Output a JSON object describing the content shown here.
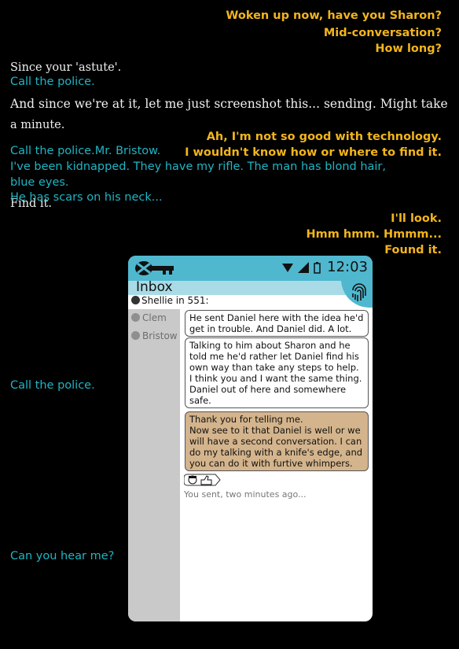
{
  "narration": {
    "yellow_top": [
      "Woken up now, have you Sharon?",
      "Mid-conversation?",
      "How long?"
    ],
    "white_1": "Since your 'astute'.",
    "cyan_1": "Call the police.",
    "white_2": "And since we're at it, let me just screenshot this... sending.  Might take",
    "white_2b": "a minute.",
    "yellow_mid_1": "Ah, I'm not so good with technology.",
    "yellow_mid_2": "I wouldn't know how or where to find it.",
    "cyan_2a": "Call the police.Mr. Bristow.",
    "cyan_2b": "I've been kidnapped.  They have my rifle.  The man has blond hair,",
    "cyan_2c": "blue eyes.",
    "cyan_2d": "He has scars on his neck...",
    "white_3": "Find it.",
    "yellow_low": [
      "I'll look.",
      "Hmm hmm.  Hmmm...",
      "Found it."
    ],
    "cyan_3": "Call the police.",
    "cyan_4": "Can you hear me?"
  },
  "phone": {
    "time": "12:03",
    "inbox_title": "Inbox",
    "sender_line": "Shellie in 551:",
    "contacts": [
      "Clem",
      "Bristow"
    ],
    "messages": [
      {
        "style": "white",
        "text": "He sent Daniel here with the idea he'd get in trouble.  And Daniel did.  A lot."
      },
      {
        "style": "white",
        "text": "Talking to him about Sharon and he told me he'd rather let Daniel find his own way than take any steps to help. I think you and I want the same thing. Daniel out of here and somewhere safe."
      },
      {
        "style": "tan",
        "text": "Thank you for telling me.\nNow see to it that Daniel is well or we will have a second conversation.  I can do my talking with a knife's edge, and you can do it with furtive whimpers."
      }
    ],
    "meta": "You sent, two minutes ago...",
    "colors": {
      "status_bar": "#4fb8cf",
      "inbox_bar": "#a9dbe7",
      "sidebar": "#c9c9c9",
      "tan_bubble": "#d4b48c",
      "yellow_text": "#f2b51c",
      "cyan_text": "#1fb5c4"
    },
    "icons": [
      "app-logo-icon",
      "wifi-icon",
      "signal-icon",
      "battery-icon",
      "fingerprint-icon",
      "avatar-icon",
      "thumbs-up-icon"
    ]
  }
}
